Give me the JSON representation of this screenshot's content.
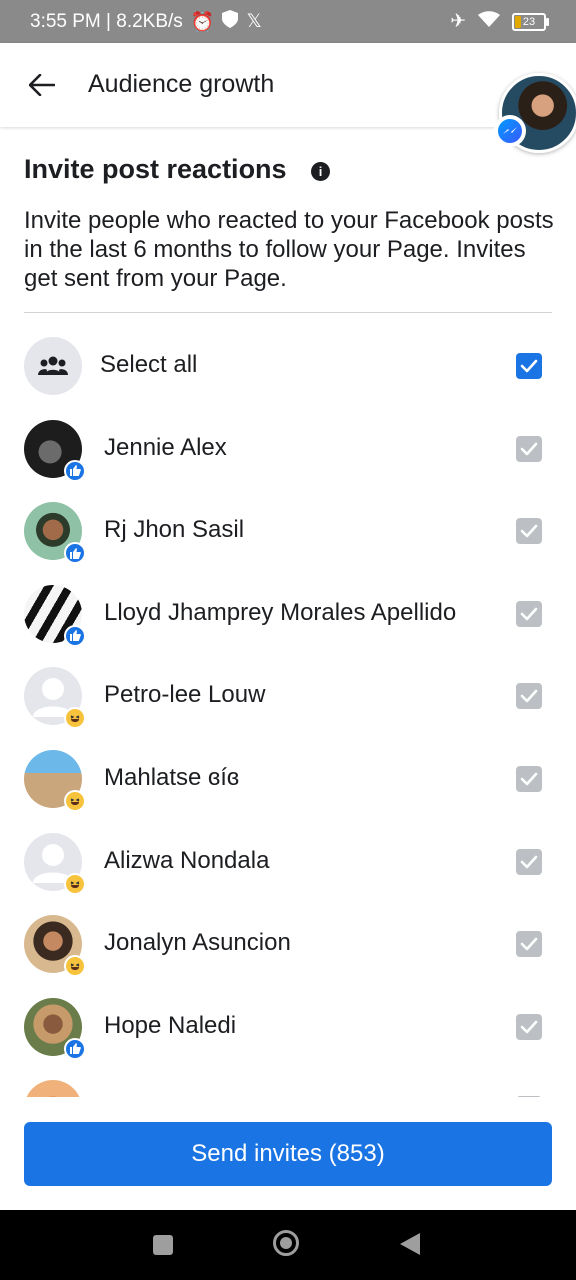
{
  "status_bar": {
    "time_speed": "3:55 PM | 8.2KB/s",
    "battery": "23"
  },
  "header": {
    "title": "Audience growth"
  },
  "section": {
    "title": "Invite post reactions",
    "description": "Invite people who reacted to your Facebook posts in the last 6 months to follow your Page. Invites get sent from your Page."
  },
  "select_all": {
    "label": "Select all",
    "checked": true
  },
  "people": [
    {
      "name": "Jennie Alex",
      "reaction": "like",
      "checked": true
    },
    {
      "name": "Rj Jhon Sasil",
      "reaction": "like",
      "checked": true
    },
    {
      "name": "Lloyd Jhamprey Morales Apellido",
      "reaction": "like",
      "checked": true
    },
    {
      "name": "Petro-lee Louw",
      "reaction": "haha",
      "checked": true
    },
    {
      "name": "Mahlatse ɞíɞ",
      "reaction": "haha",
      "checked": true
    },
    {
      "name": "Alizwa Nondala",
      "reaction": "haha",
      "checked": true
    },
    {
      "name": "Jonalyn Asuncion",
      "reaction": "haha",
      "checked": true
    },
    {
      "name": "Hope Naledi",
      "reaction": "like",
      "checked": true
    }
  ],
  "send_button": {
    "label": "Send invites (853)"
  },
  "colors": {
    "primary": "#1b74e4",
    "checked_disabled": "#bcc0c4"
  }
}
